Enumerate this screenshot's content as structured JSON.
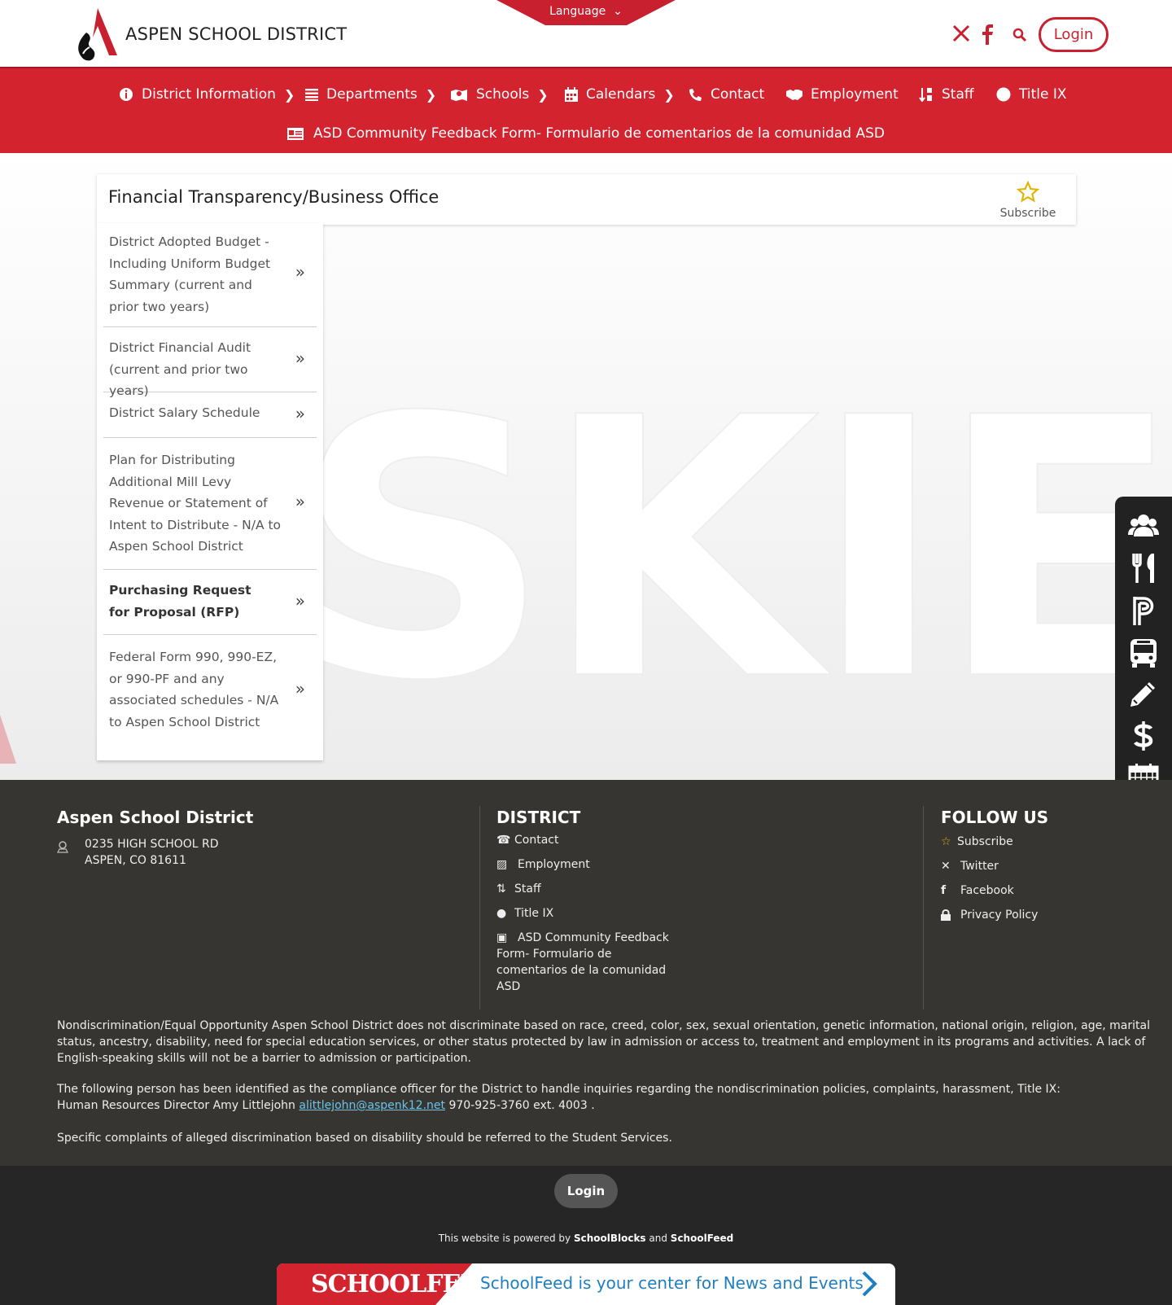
{
  "header": {
    "site_name": "ASPEN SCHOOL DISTRICT",
    "language_label": "Language",
    "login_label": "Login"
  },
  "nav": {
    "items": [
      {
        "label": "District Information",
        "icon": "info-circle-icon",
        "has_chevron": true
      },
      {
        "label": "Departments",
        "icon": "list-icon",
        "has_chevron": true
      },
      {
        "label": "Schools",
        "icon": "school-map-icon",
        "has_chevron": true
      },
      {
        "label": "Calendars",
        "icon": "calendar-icon",
        "has_chevron": true
      },
      {
        "label": "Contact",
        "icon": "phone-icon",
        "has_chevron": false
      },
      {
        "label": "Employment",
        "icon": "handshake-icon",
        "has_chevron": false
      },
      {
        "label": "Staff",
        "icon": "sort-icon",
        "has_chevron": false
      },
      {
        "label": "Title IX",
        "icon": "circle-icon",
        "has_chevron": false
      }
    ],
    "feedback_label": "ASD Community Feedback Form- Formulario de comentarios de la comunidad ASD"
  },
  "main": {
    "page_title": "Financial Transparency/Business Office",
    "subscribe_label": "Subscribe",
    "side_items": [
      {
        "label": "District Adopted Budget - Including Uniform Budget Summary (current and prior two years)",
        "bold": false
      },
      {
        "label": "District Financial Audit (current and prior two years)",
        "bold": false
      },
      {
        "label": "District Salary Schedule",
        "bold": false
      },
      {
        "label": "Plan for Distributing Additional Mill Levy Revenue or Statement of Intent to Distribute - N/A to Aspen School District",
        "bold": false
      },
      {
        "label": "Purchasing Request for Proposal (RFP)",
        "bold": true
      },
      {
        "label": "Federal Form 990, 990-EZ, or 990-PF and any associated schedules - N/A to Aspen School District",
        "bold": false
      }
    ],
    "background_text": "SKIERS",
    "quick_links": [
      "people-icon",
      "fork-knife-icon",
      "powerschool-icon",
      "bus-icon",
      "pencil-icon",
      "dollar-icon",
      "calendar-grid-icon"
    ]
  },
  "footer": {
    "district_name": "Aspen School District",
    "address_line1": "0235 HIGH SCHOOL RD",
    "address_line2": "ASPEN, CO 81611",
    "district_title": "DISTRICT",
    "district_links": {
      "contact": "Contact",
      "employment": "Employment",
      "staff": "Staff",
      "title_ix": "Title IX",
      "feedback_1": "ASD Community Feedback",
      "feedback_2": "Form- Formulario de",
      "feedback_3": "comentarios de la comunidad",
      "feedback_4": "ASD"
    },
    "follow_title": "FOLLOW US",
    "follow_links": {
      "subscribe": "Subscribe",
      "twitter": "Twitter",
      "facebook": "Facebook",
      "privacy": "Privacy Policy"
    },
    "nondiscrimination": "Nondiscrimination/Equal Opportunity Aspen School District does not discriminate based on race, creed, color, sex, sexual orientation, genetic information, national origin, religion, age, marital status, ancestry, disability, need for special education services, or other status protected by law in admission or access to, treatment and employment in its programs and activities. A lack of English-speaking skills will not be a barrier to admission or participation.",
    "compliance_line1": "The following person has been identified as the compliance officer for the District to handle inquiries regarding the nondiscrimination policies, complaints, harassment, Title IX:",
    "compliance_prefix": "Human Resources Director Amy Littlejohn ",
    "compliance_email": "alittlejohn@aspenk12.net",
    "compliance_suffix": " 970-925-3760 ext. 4003 .",
    "disability_note": "Specific complaints of alleged discrimination based on disability should be referred to the Student Services."
  },
  "bottom": {
    "login_label": "Login",
    "powered_prefix": "This website is powered by ",
    "powered_brand1": "SchoolBlocks",
    "powered_and": " and ",
    "powered_brand2": "SchoolFeed",
    "schoolfeed_logo": "SCHOOLFEED",
    "schoolfeed_message": "SchoolFeed is your center for News and Events"
  },
  "colors": {
    "brand_red": "#d2232f",
    "footer_bg": "#363531",
    "bottom_bg": "#262626",
    "link_blue": "#1f7fc0",
    "star_gold": "#e0b400"
  }
}
